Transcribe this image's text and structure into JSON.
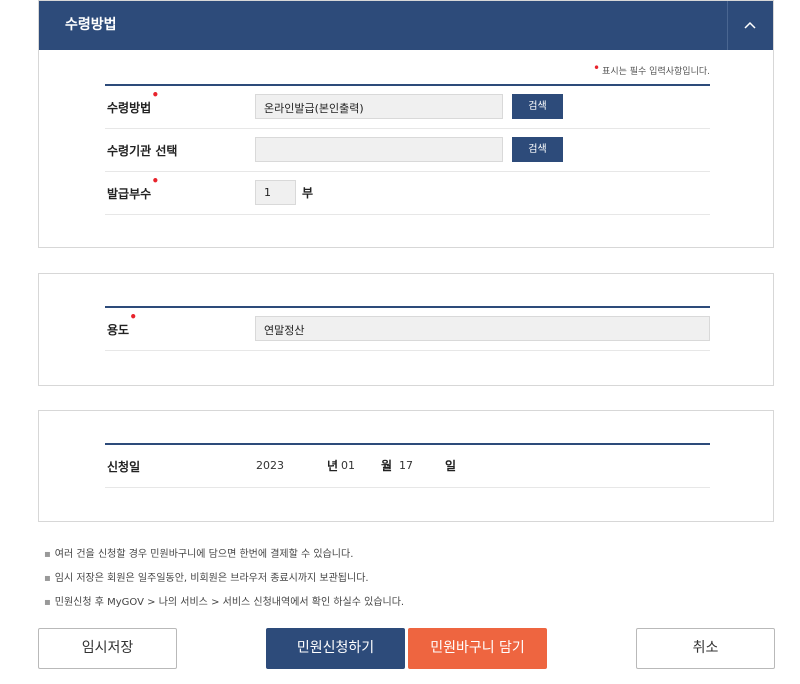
{
  "receipt_panel": {
    "title": "수령방법",
    "required_note": "표시는 필수 입력사항입니다.",
    "rows": [
      {
        "label": "수령방법",
        "value": "온라인발급(본인출력)",
        "button": "검색"
      },
      {
        "label": "수령기관 선택",
        "value": "",
        "button": "검색"
      },
      {
        "label": "발급부수",
        "value": "1",
        "unit": "부"
      }
    ]
  },
  "purpose_panel": {
    "label": "용도",
    "value": "연말정산"
  },
  "date_panel": {
    "label": "신청일",
    "year": "2023",
    "year_unit": "년",
    "month": "01",
    "month_unit": "월",
    "day": "17",
    "day_unit": "일"
  },
  "notes": [
    "여러 건을 신청할 경우 민원바구니에 담으면 한번에 결제할 수 있습니다.",
    "임시 저장은 회원은 일주일동안, 비회원은 브라우저 종료시까지 보관됩니다.",
    "민원신청 후 MyGOV > 나의 서비스 > 서비스 신청내역에서 확인 하실수 있습니다."
  ],
  "buttons": {
    "temp_save": "임시저장",
    "apply": "민원신청하기",
    "add_to_basket": "민원바구니 담기",
    "cancel": "취소"
  },
  "colors": {
    "header_navy": "#2d4b7a",
    "required_red": "#e8232c",
    "basket_orange": "#ee6540"
  }
}
